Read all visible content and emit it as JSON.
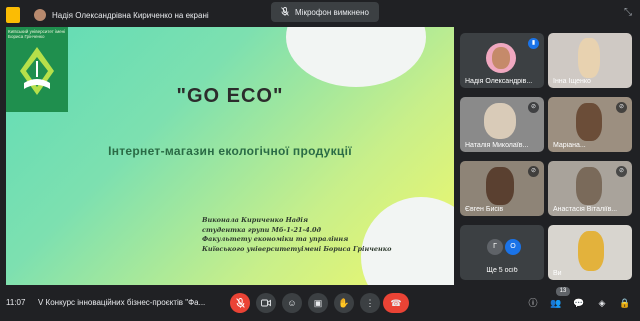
{
  "topbar": {
    "presenter_label": "Надія Олександрівна Кириченко на екрані",
    "mic_toast": "Мікрофон вимкнено"
  },
  "slide": {
    "logo_text": "Київський університет імені Бориса Грінченко",
    "title": "\"GO ECO\"",
    "subtitle": "Інтернет-магазин екологічної продукції",
    "credits": [
      "Виконала Кириченко Надія",
      "студентка групи Мб-1-21-4.0д",
      "Факультету економіки та упраління",
      "Київського університетуімені Бориса Грінченко"
    ]
  },
  "participants": [
    {
      "name": "Надія Олександрів...",
      "status": "speaking"
    },
    {
      "name": "Інна Іщенко",
      "status": ""
    },
    {
      "name": "Наталія Миколаїв...",
      "status": "muted"
    },
    {
      "name": "Маріана...",
      "status": "muted"
    },
    {
      "name": "Євген Бисів",
      "status": "muted"
    },
    {
      "name": "Анастасія Віталіїв...",
      "status": "muted"
    },
    {
      "name": "Ще 5 осіб",
      "status": "",
      "initials": [
        "Г",
        "О"
      ]
    },
    {
      "name": "Ви",
      "status": ""
    }
  ],
  "bottombar": {
    "clock": "11:07",
    "meeting_title": "V Конкурс інноваційних бізнес-проєктів \"Фа...",
    "participant_count": "13"
  },
  "colors": {
    "background": "#202124",
    "tile": "#3c4043",
    "end_call": "#ea4335",
    "speaking": "#1a73e8"
  }
}
